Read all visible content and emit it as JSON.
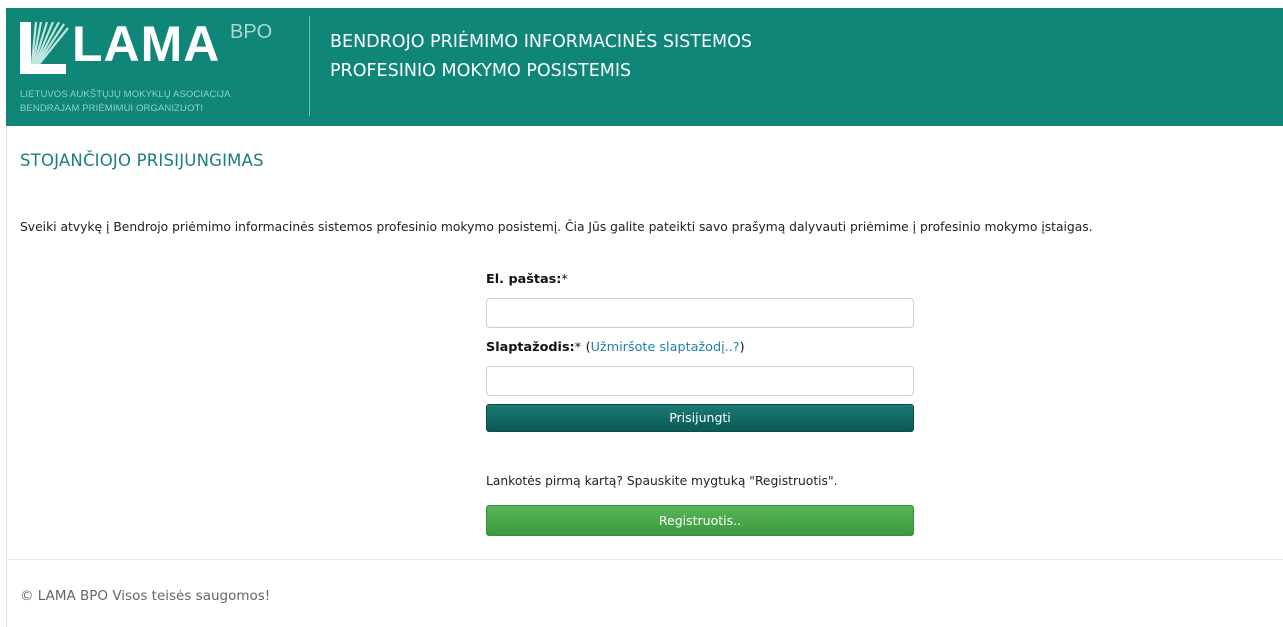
{
  "header": {
    "logo_text": "LAMA",
    "logo_superscript": "BPO",
    "logo_subtitle_line1": "LIETUVOS AUKŠTŲJŲ MOKYKLŲ ASOCIACIJA",
    "logo_subtitle_line2": "BENDRAJAM PRIĖMIMUI ORGANIZUOTI",
    "system_title_line1": "BENDROJO PRIĖMIMO INFORMACINĖS SISTEMOS",
    "system_title_line2": "PROFESINIO MOKYMO POSISTEMIS",
    "background_color": "#0f8677"
  },
  "page": {
    "title": "STOJANČIOJO PRISIJUNGIMAS",
    "welcome_text": "Sveiki atvykę į Bendrojo priėmimo informacinės sistemos profesinio mokymo posistemį. Čia Jūs galite pateikti savo prašymą dalyvauti priėmime į profesinio mokymo įstaigas."
  },
  "login_form": {
    "email_label": "El. paštas:",
    "email_required": "*",
    "email_value": "",
    "password_label": "Slaptažodis:",
    "password_required": "*",
    "forgot_open": "(",
    "forgot_link": "Užmiršote slaptažodį..?",
    "forgot_close": ")",
    "password_value": "",
    "login_button": "Prisijungti"
  },
  "register": {
    "note": "Lankotės pirmą kartą? Spauskite mygtuką \"Registruotis\".",
    "button": "Registruotis.."
  },
  "footer": {
    "copyright": "© LAMA BPO Visos teisės saugomos!"
  },
  "colors": {
    "accent": "#0f8677",
    "title": "#1b7f77",
    "login_button": "#0b5a55",
    "register_button": "#4aa84b",
    "link": "#1f7fb0"
  }
}
